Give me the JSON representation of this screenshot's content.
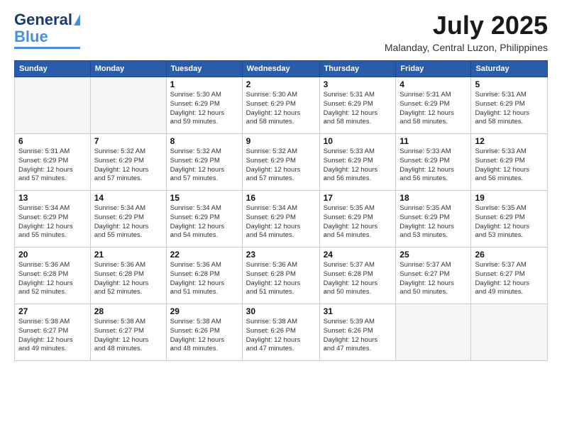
{
  "logo": {
    "text1": "General",
    "text2": "Blue"
  },
  "title": "July 2025",
  "location": "Malanday, Central Luzon, Philippines",
  "weekdays": [
    "Sunday",
    "Monday",
    "Tuesday",
    "Wednesday",
    "Thursday",
    "Friday",
    "Saturday"
  ],
  "weeks": [
    [
      {
        "day": "",
        "info": ""
      },
      {
        "day": "",
        "info": ""
      },
      {
        "day": "1",
        "info": "Sunrise: 5:30 AM\nSunset: 6:29 PM\nDaylight: 12 hours\nand 59 minutes."
      },
      {
        "day": "2",
        "info": "Sunrise: 5:30 AM\nSunset: 6:29 PM\nDaylight: 12 hours\nand 58 minutes."
      },
      {
        "day": "3",
        "info": "Sunrise: 5:31 AM\nSunset: 6:29 PM\nDaylight: 12 hours\nand 58 minutes."
      },
      {
        "day": "4",
        "info": "Sunrise: 5:31 AM\nSunset: 6:29 PM\nDaylight: 12 hours\nand 58 minutes."
      },
      {
        "day": "5",
        "info": "Sunrise: 5:31 AM\nSunset: 6:29 PM\nDaylight: 12 hours\nand 58 minutes."
      }
    ],
    [
      {
        "day": "6",
        "info": "Sunrise: 5:31 AM\nSunset: 6:29 PM\nDaylight: 12 hours\nand 57 minutes."
      },
      {
        "day": "7",
        "info": "Sunrise: 5:32 AM\nSunset: 6:29 PM\nDaylight: 12 hours\nand 57 minutes."
      },
      {
        "day": "8",
        "info": "Sunrise: 5:32 AM\nSunset: 6:29 PM\nDaylight: 12 hours\nand 57 minutes."
      },
      {
        "day": "9",
        "info": "Sunrise: 5:32 AM\nSunset: 6:29 PM\nDaylight: 12 hours\nand 57 minutes."
      },
      {
        "day": "10",
        "info": "Sunrise: 5:33 AM\nSunset: 6:29 PM\nDaylight: 12 hours\nand 56 minutes."
      },
      {
        "day": "11",
        "info": "Sunrise: 5:33 AM\nSunset: 6:29 PM\nDaylight: 12 hours\nand 56 minutes."
      },
      {
        "day": "12",
        "info": "Sunrise: 5:33 AM\nSunset: 6:29 PM\nDaylight: 12 hours\nand 56 minutes."
      }
    ],
    [
      {
        "day": "13",
        "info": "Sunrise: 5:34 AM\nSunset: 6:29 PM\nDaylight: 12 hours\nand 55 minutes."
      },
      {
        "day": "14",
        "info": "Sunrise: 5:34 AM\nSunset: 6:29 PM\nDaylight: 12 hours\nand 55 minutes."
      },
      {
        "day": "15",
        "info": "Sunrise: 5:34 AM\nSunset: 6:29 PM\nDaylight: 12 hours\nand 54 minutes."
      },
      {
        "day": "16",
        "info": "Sunrise: 5:34 AM\nSunset: 6:29 PM\nDaylight: 12 hours\nand 54 minutes."
      },
      {
        "day": "17",
        "info": "Sunrise: 5:35 AM\nSunset: 6:29 PM\nDaylight: 12 hours\nand 54 minutes."
      },
      {
        "day": "18",
        "info": "Sunrise: 5:35 AM\nSunset: 6:29 PM\nDaylight: 12 hours\nand 53 minutes."
      },
      {
        "day": "19",
        "info": "Sunrise: 5:35 AM\nSunset: 6:29 PM\nDaylight: 12 hours\nand 53 minutes."
      }
    ],
    [
      {
        "day": "20",
        "info": "Sunrise: 5:36 AM\nSunset: 6:28 PM\nDaylight: 12 hours\nand 52 minutes."
      },
      {
        "day": "21",
        "info": "Sunrise: 5:36 AM\nSunset: 6:28 PM\nDaylight: 12 hours\nand 52 minutes."
      },
      {
        "day": "22",
        "info": "Sunrise: 5:36 AM\nSunset: 6:28 PM\nDaylight: 12 hours\nand 51 minutes."
      },
      {
        "day": "23",
        "info": "Sunrise: 5:36 AM\nSunset: 6:28 PM\nDaylight: 12 hours\nand 51 minutes."
      },
      {
        "day": "24",
        "info": "Sunrise: 5:37 AM\nSunset: 6:28 PM\nDaylight: 12 hours\nand 50 minutes."
      },
      {
        "day": "25",
        "info": "Sunrise: 5:37 AM\nSunset: 6:27 PM\nDaylight: 12 hours\nand 50 minutes."
      },
      {
        "day": "26",
        "info": "Sunrise: 5:37 AM\nSunset: 6:27 PM\nDaylight: 12 hours\nand 49 minutes."
      }
    ],
    [
      {
        "day": "27",
        "info": "Sunrise: 5:38 AM\nSunset: 6:27 PM\nDaylight: 12 hours\nand 49 minutes."
      },
      {
        "day": "28",
        "info": "Sunrise: 5:38 AM\nSunset: 6:27 PM\nDaylight: 12 hours\nand 48 minutes."
      },
      {
        "day": "29",
        "info": "Sunrise: 5:38 AM\nSunset: 6:26 PM\nDaylight: 12 hours\nand 48 minutes."
      },
      {
        "day": "30",
        "info": "Sunrise: 5:38 AM\nSunset: 6:26 PM\nDaylight: 12 hours\nand 47 minutes."
      },
      {
        "day": "31",
        "info": "Sunrise: 5:39 AM\nSunset: 6:26 PM\nDaylight: 12 hours\nand 47 minutes."
      },
      {
        "day": "",
        "info": ""
      },
      {
        "day": "",
        "info": ""
      }
    ]
  ]
}
